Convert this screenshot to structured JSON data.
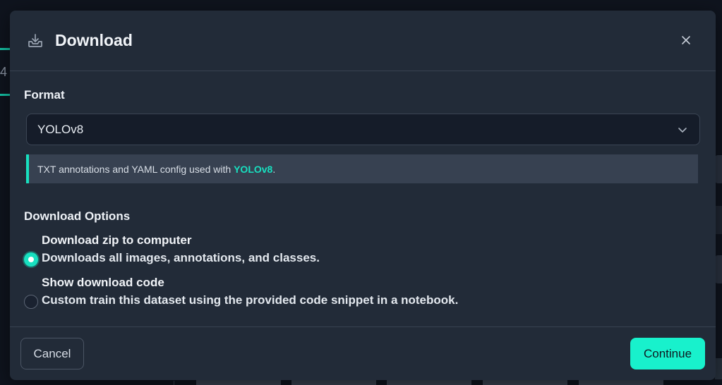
{
  "background": {
    "tab_number": "4"
  },
  "dialog": {
    "title": "Download",
    "header_icon": "download-tray-icon",
    "close_icon": "close-icon"
  },
  "format": {
    "label": "Format",
    "selected": "YOLOv8",
    "info_prefix": "TXT annotations and YAML config used with ",
    "info_highlight": "YOLOv8",
    "info_suffix": "."
  },
  "download_options": {
    "label": "Download Options",
    "options": [
      {
        "title": "Download zip to computer",
        "description": "Downloads all images, annotations, and classes.",
        "selected": true
      },
      {
        "title": "Show download code",
        "description": "Custom train this dataset using the provided code snippet in a notebook.",
        "selected": false
      }
    ]
  },
  "footer": {
    "cancel_label": "Cancel",
    "continue_label": "Continue"
  },
  "colors": {
    "accent": "#18e0c0",
    "button_primary": "#18f1cc",
    "modal_bg": "#222b38",
    "page_bg": "#0f141e"
  }
}
